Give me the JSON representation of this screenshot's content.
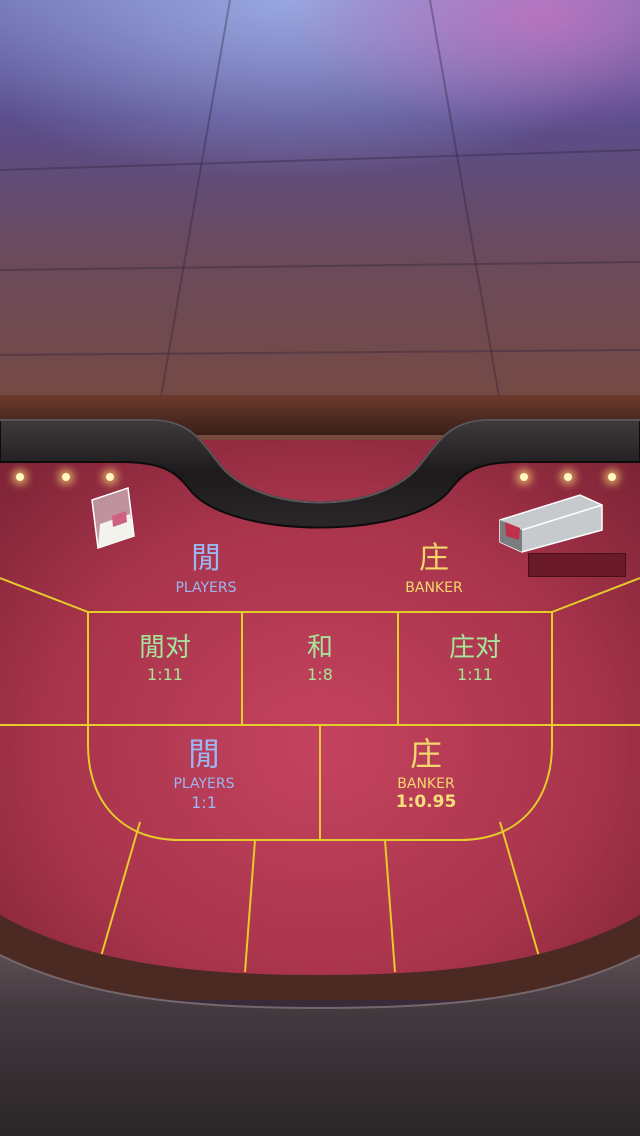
{
  "table": {
    "players_header": {
      "cjk": "閒",
      "en": "PLAYERS"
    },
    "banker_header": {
      "cjk": "庄",
      "en": "BANKER"
    },
    "player_pair": {
      "cjk": "閒对",
      "odds": "1:11"
    },
    "tie": {
      "cjk": "和",
      "odds": "1:8"
    },
    "banker_pair": {
      "cjk": "庄对",
      "odds": "1:11"
    },
    "players_bet": {
      "cjk": "閒",
      "en": "PLAYERS",
      "odds": "1:1"
    },
    "banker_bet": {
      "cjk": "庄",
      "en": "BANKER",
      "odds": "1:0.95"
    }
  },
  "colors": {
    "felt": "#b0394f",
    "lines": "#e4cc2a",
    "player_text": "#9bb6f0",
    "banker_text": "#f3d86a",
    "side_text": "#a6e59a"
  },
  "icons": {
    "discard_box": "discard-tray-icon",
    "card_shoe": "card-shoe-icon"
  }
}
